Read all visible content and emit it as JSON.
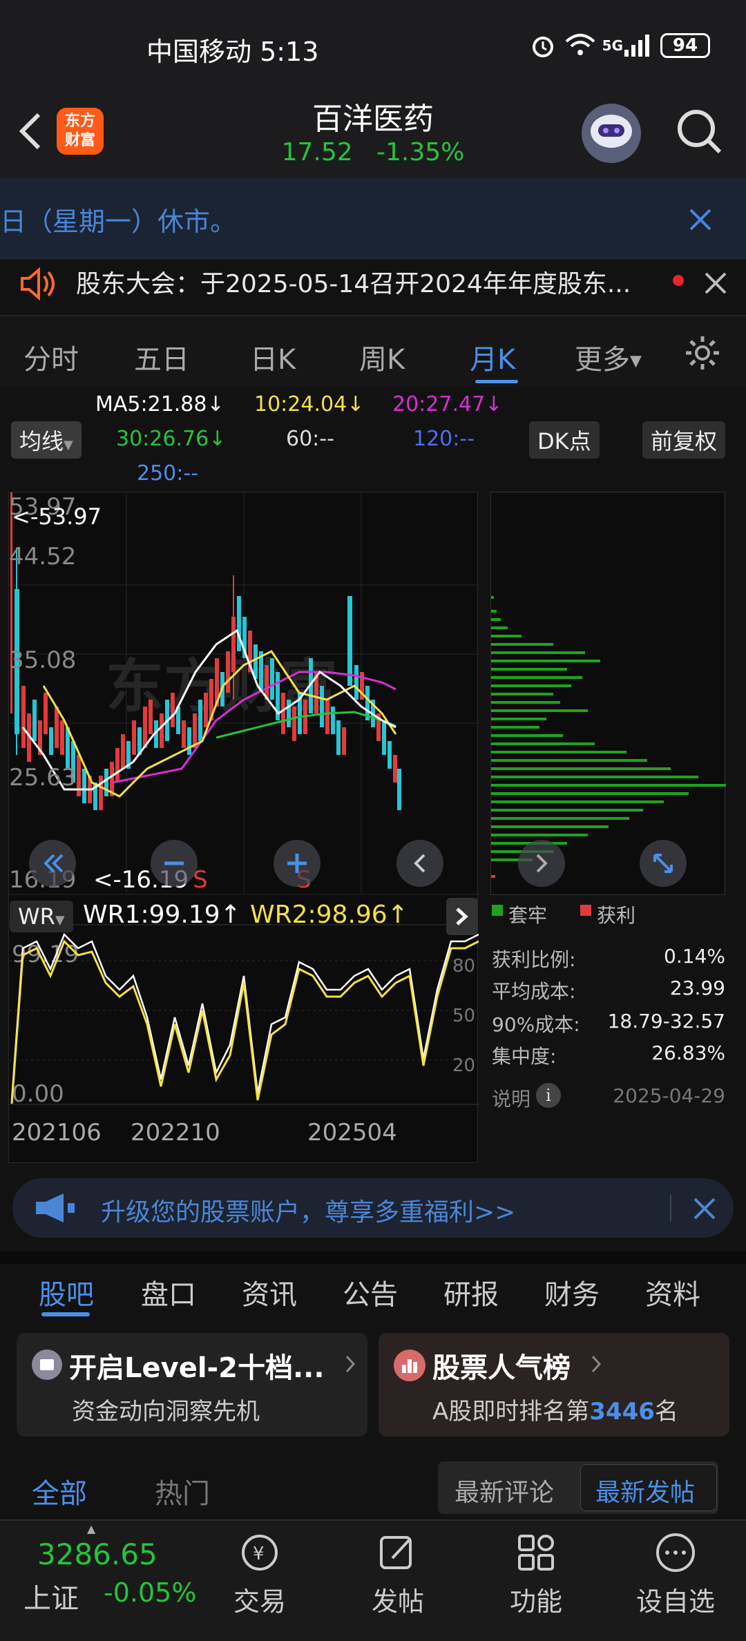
{
  "status_bar": {
    "carrier_time": "中国移动 5:13",
    "network": "5G",
    "battery": "94"
  },
  "header": {
    "title": "百洋医药",
    "price": "17.52",
    "change": "-1.35%",
    "logo_text": "东方财富"
  },
  "notices": {
    "market_closed": "日（星期一）休市。",
    "shareholder_meeting": "股东大会：于2025-05-14召开2024年年度股东..."
  },
  "period_tabs": [
    {
      "label": "分时"
    },
    {
      "label": "五日"
    },
    {
      "label": "日K"
    },
    {
      "label": "周K"
    },
    {
      "label": "月K"
    },
    {
      "label": "更多"
    }
  ],
  "active_tab": "月K",
  "indicators": {
    "ma_selector": "均线",
    "ma5": "MA5:21.88↓",
    "ma10": "10:24.04↓",
    "ma20": "20:27.47↓",
    "ma30": "30:26.76↓",
    "ma60": "60:--",
    "ma120": "120:--",
    "ma250": "250:--",
    "dk_button": "DK点",
    "adjust_button": "前复权"
  },
  "colors": {
    "up": "#e23b3b",
    "down": "#25c6d6",
    "ma5": "#ffffff",
    "ma10": "#f3e146",
    "ma20": "#d62ed6",
    "ma30": "#25c43b",
    "accent": "#4a90e8",
    "green_text": "#25c43b"
  },
  "kline": {
    "watermark": "东方财富",
    "y_labels": [
      "53.97",
      "44.52",
      "35.08",
      "25.63",
      "16.19"
    ],
    "high_label": "<-53.97",
    "low_label": "<-16.19",
    "signal": "S"
  },
  "wr": {
    "selector": "WR",
    "wr1": "WR1:99.19↑",
    "wr2": "WR2:98.96↑",
    "y_top": "99.19",
    "y_bottom": "0.00",
    "levels": [
      "80",
      "50",
      "20"
    ]
  },
  "x_axis": [
    "202106",
    "202210",
    "202504"
  ],
  "chip": {
    "legend_trapped": "套牢",
    "legend_profit": "获利",
    "rows": [
      {
        "label": "获利比例:",
        "value": "0.14%"
      },
      {
        "label": "平均成本:",
        "value": "23.99"
      },
      {
        "label": "90%成本:",
        "value": "18.79-32.57"
      },
      {
        "label": "集中度:",
        "value": "26.83%"
      }
    ],
    "note_label": "说明",
    "date": "2025-04-29"
  },
  "promo_banner": "升级您的股票账户，尊享多重福利>>",
  "info_tabs": [
    {
      "label": "股吧"
    },
    {
      "label": "盘口"
    },
    {
      "label": "资讯"
    },
    {
      "label": "公告"
    },
    {
      "label": "研报"
    },
    {
      "label": "财务"
    },
    {
      "label": "资料"
    }
  ],
  "cards": {
    "level2_title": "开启Level-2十档...",
    "level2_sub": "资金动向洞察先机",
    "rank_title": "股票人气榜",
    "rank_sub_prefix": "A股即时排名第",
    "rank_num": "3446",
    "rank_sub_suffix": "名"
  },
  "feed_tabs": {
    "all": "全部",
    "hot": "热门",
    "latest_comment": "最新评论",
    "latest_post": "最新发帖"
  },
  "bottom_bar": {
    "index_value": "3286.65",
    "index_name": "上证",
    "index_change": "-0.05%",
    "items": [
      {
        "label": "交易"
      },
      {
        "label": "发帖"
      },
      {
        "label": "功能"
      },
      {
        "label": "设自选"
      }
    ]
  }
}
